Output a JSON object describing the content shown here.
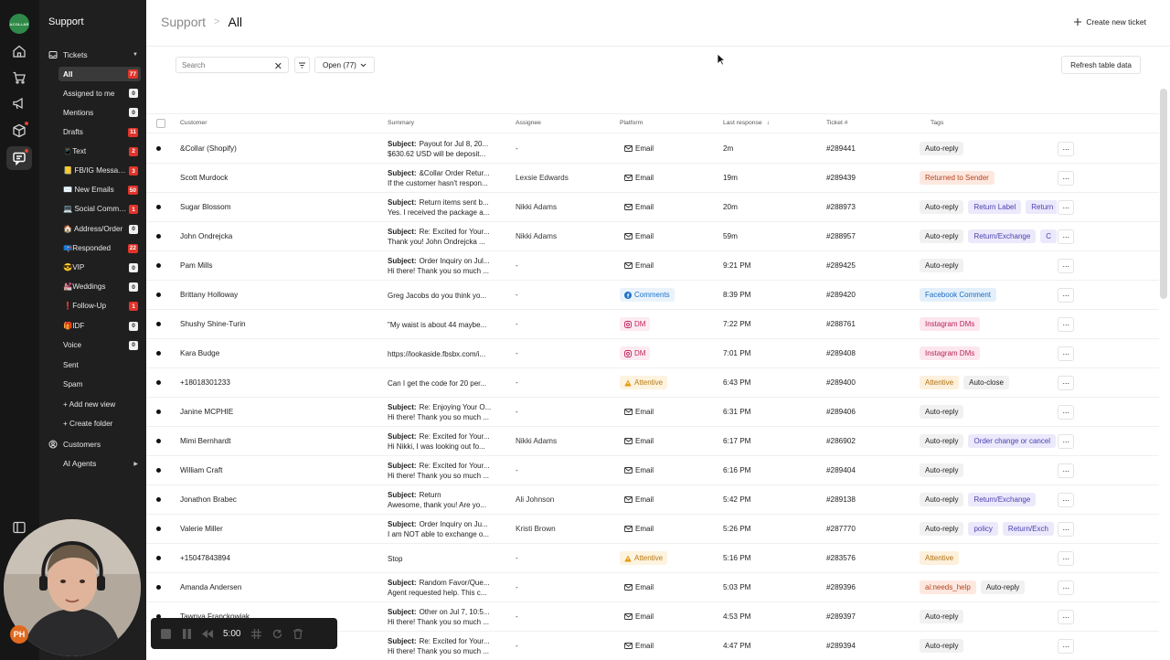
{
  "app": {
    "logo_text": "ACOLLAR"
  },
  "sidebar": {
    "title": "Support",
    "tickets_label": "Tickets",
    "items": [
      {
        "label": "All",
        "count": "77",
        "badge": "red",
        "selected": true
      },
      {
        "label": "Assigned to me",
        "count": "0",
        "badge": "gray"
      },
      {
        "label": "Mentions",
        "count": "0",
        "badge": "gray"
      },
      {
        "label": "Drafts",
        "count": "11",
        "badge": "red"
      },
      {
        "label": "📱Text",
        "count": "2",
        "badge": "red"
      },
      {
        "label": "📒 FB/IG Messages",
        "count": "3",
        "badge": "red"
      },
      {
        "label": "✉️ New Emails",
        "count": "50",
        "badge": "red"
      },
      {
        "label": "💻 Social Comments",
        "count": "1",
        "badge": "red"
      },
      {
        "label": "🏠 Address/Order",
        "count": "0",
        "badge": "gray"
      },
      {
        "label": "📪Responded",
        "count": "22",
        "badge": "red"
      },
      {
        "label": "😎VIP",
        "count": "0",
        "badge": "gray"
      },
      {
        "label": "💒Weddings",
        "count": "0",
        "badge": "gray"
      },
      {
        "label": "❗Follow-Up",
        "count": "1",
        "badge": "red"
      },
      {
        "label": "🎁IDF",
        "count": "0",
        "badge": "gray"
      },
      {
        "label": "Voice",
        "count": "0",
        "badge": "gray"
      },
      {
        "label": "Sent",
        "count": "",
        "badge": ""
      },
      {
        "label": "Spam",
        "count": "",
        "badge": ""
      }
    ],
    "add_view": "+ Add new view",
    "create_folder": "+ Create folder",
    "customers": "Customers",
    "ai_agents": "AI Agents"
  },
  "header": {
    "crumb_root": "Support",
    "crumb_current": "All",
    "create_ticket": "Create new ticket"
  },
  "toolbar": {
    "search_placeholder": "Search",
    "status_filter": "Open (77)",
    "refresh": "Refresh table data"
  },
  "table": {
    "columns": {
      "customer": "Customer",
      "summary": "Summary",
      "assignee": "Assignee",
      "platform": "Platform",
      "last_response": "Last response",
      "ticket": "Ticket #",
      "tags": "Tags"
    },
    "rows": [
      {
        "customer": "&Collar (Shopify)",
        "s1": "Payout for Jul 8, 20...",
        "s2": "$630.62 USD will be deposit...",
        "assignee": "-",
        "platform": "Email",
        "last": "2m",
        "ticket": "#289441",
        "tags": [
          "Auto-reply"
        ],
        "unread": true
      },
      {
        "customer": "Scott Murdock",
        "s1": "&Collar Order Retur...",
        "s2": "If the customer hasn't respon...",
        "assignee": "Lexsie Edwards",
        "platform": "Email",
        "last": "19m",
        "ticket": "#289439",
        "tags": [
          "Returned to Sender"
        ],
        "unread": false
      },
      {
        "customer": "Sugar Blossom",
        "s1": "Return items sent b...",
        "s2": "Yes. I received the package a...",
        "assignee": "Nikki Adams",
        "platform": "Email",
        "last": "20m",
        "ticket": "#288973",
        "tags": [
          "Auto-reply",
          "Return Label",
          "Return"
        ],
        "unread": true
      },
      {
        "customer": "John Ondrejcka",
        "s1": "Re: Excited for Your...",
        "s2": "Thank you! John Ondrejcka ...",
        "assignee": "Nikki Adams",
        "platform": "Email",
        "last": "59m",
        "ticket": "#288957",
        "tags": [
          "Auto-reply",
          "Return/Exchange",
          "C"
        ],
        "unread": true
      },
      {
        "customer": "Pam Mills",
        "s1": "Order Inquiry on Jul...",
        "s2": "Hi there! Thank you so much ...",
        "assignee": "-",
        "platform": "Email",
        "last": "9:21 PM",
        "ticket": "#289425",
        "tags": [
          "Auto-reply"
        ],
        "unread": true
      },
      {
        "customer": "Brittany Holloway",
        "single": "Greg Jacobs do you think yo...",
        "assignee": "-",
        "platform": "Comments",
        "last": "8:39 PM",
        "ticket": "#289420",
        "tags": [
          "Facebook Comment"
        ],
        "unread": true
      },
      {
        "customer": "Shushy Shine-Turin",
        "single": "\"My waist is about 44 maybe...",
        "assignee": "-",
        "platform": "DM",
        "last": "7:22 PM",
        "ticket": "#288761",
        "tags": [
          "Instagram DMs"
        ],
        "unread": true
      },
      {
        "customer": "Kara Budge",
        "single": "https://lookaside.fbsbx.com/i...",
        "assignee": "-",
        "platform": "DM",
        "last": "7:01 PM",
        "ticket": "#289408",
        "tags": [
          "Instagram DMs"
        ],
        "unread": true
      },
      {
        "customer": "+18018301233",
        "single": "Can I get the code for 20 per...",
        "assignee": "-",
        "platform": "Attentive",
        "last": "6:43 PM",
        "ticket": "#289400",
        "tags": [
          "Attentive",
          "Auto-close"
        ],
        "unread": true
      },
      {
        "customer": "Janine MCPHIE",
        "s1": "Re: Enjoying Your O...",
        "s2": "Hi there! Thank you so much ...",
        "assignee": "-",
        "platform": "Email",
        "last": "6:31 PM",
        "ticket": "#289406",
        "tags": [
          "Auto-reply"
        ],
        "unread": true
      },
      {
        "customer": "Mimi Bernhardt",
        "s1": "Re: Excited for Your...",
        "s2": "Hi Nikki, I was looking out fo...",
        "assignee": "Nikki Adams",
        "platform": "Email",
        "last": "6:17 PM",
        "ticket": "#286902",
        "tags": [
          "Auto-reply",
          "Order change or cancel"
        ],
        "unread": true
      },
      {
        "customer": "William Craft",
        "s1": "Re: Excited for Your...",
        "s2": "Hi there! Thank you so much ...",
        "assignee": "-",
        "platform": "Email",
        "last": "6:16 PM",
        "ticket": "#289404",
        "tags": [
          "Auto-reply"
        ],
        "unread": true
      },
      {
        "customer": "Jonathon Brabec",
        "s1": "Return",
        "s2": "Awesome, thank you! Are yo...",
        "assignee": "Ali Johnson",
        "platform": "Email",
        "last": "5:42 PM",
        "ticket": "#289138",
        "tags": [
          "Auto-reply",
          "Return/Exchange"
        ],
        "unread": true
      },
      {
        "customer": "Valerie Miller",
        "s1": "Order Inquiry on Ju...",
        "s2": "I am NOT able to exchange o...",
        "assignee": "Kristi Brown",
        "platform": "Email",
        "last": "5:26 PM",
        "ticket": "#287770",
        "tags": [
          "Auto-reply",
          "policy",
          "Return/Exch"
        ],
        "unread": true
      },
      {
        "customer": "+15047843894",
        "single": "Stop",
        "assignee": "-",
        "platform": "Attentive",
        "last": "5:16 PM",
        "ticket": "#283576",
        "tags": [
          "Attentive"
        ],
        "unread": true
      },
      {
        "customer": "Amanda Andersen",
        "s1": "Random Favor/Que...",
        "s2": "Agent requested help. This c...",
        "assignee": "-",
        "platform": "Email",
        "last": "5:03 PM",
        "ticket": "#289396",
        "tags": [
          "ai:needs_help",
          "Auto-reply"
        ],
        "unread": true
      },
      {
        "customer": "Tawnya Franckowiak",
        "s1": "Other on Jul 7, 10:5...",
        "s2": "Hi there! Thank you so much ...",
        "assignee": "-",
        "platform": "Email",
        "last": "4:53 PM",
        "ticket": "#289397",
        "tags": [
          "Auto-reply"
        ],
        "unread": true
      },
      {
        "customer": "",
        "s1": "Re: Excited for Your...",
        "s2": "Hi there! Thank you so much ...",
        "assignee": "-",
        "platform": "Email",
        "last": "4:47 PM",
        "ticket": "#289394",
        "tags": [
          "Auto-reply"
        ],
        "unread": true
      }
    ],
    "subject_prefix": "Subject:"
  },
  "tag_styles": {
    "Auto-reply": {
      "bg": "#f1f1f1",
      "fg": "#222"
    },
    "Auto-close": {
      "bg": "#f1f1f1",
      "fg": "#222"
    },
    "Returned to Sender": {
      "bg": "#fde8e0",
      "fg": "#b5431c"
    },
    "Return Label": {
      "bg": "#ebe9fb",
      "fg": "#4a3fb0"
    },
    "Return": {
      "bg": "#ebe9fb",
      "fg": "#4a3fb0"
    },
    "Return/Exchange": {
      "bg": "#ebe9fb",
      "fg": "#4a3fb0"
    },
    "Return/Exch": {
      "bg": "#ebe9fb",
      "fg": "#4a3fb0"
    },
    "C": {
      "bg": "#ebe9fb",
      "fg": "#4a3fb0"
    },
    "Order change or cancel": {
      "bg": "#ebe9fb",
      "fg": "#4a3fb0"
    },
    "policy": {
      "bg": "#ebe9fb",
      "fg": "#4a3fb0"
    },
    "Facebook Comment": {
      "bg": "#e3f0fb",
      "fg": "#1a6cc0"
    },
    "Instagram DMs": {
      "bg": "#fde6ee",
      "fg": "#b8245a"
    },
    "Attentive": {
      "bg": "#fdf0dc",
      "fg": "#b0700c"
    },
    "ai:needs_help": {
      "bg": "#fde8e0",
      "fg": "#b5431c"
    }
  },
  "recorder": {
    "time": "5:00"
  },
  "webcam": {
    "initials": "PH"
  }
}
